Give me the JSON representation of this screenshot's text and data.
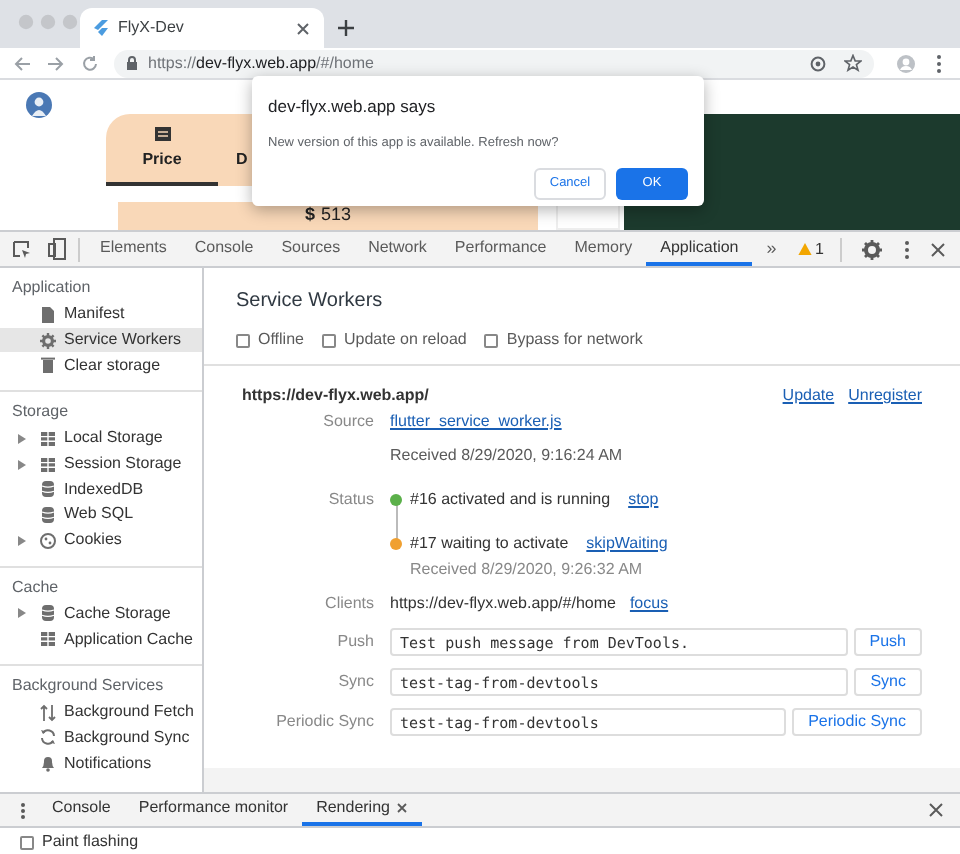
{
  "browser": {
    "tab": {
      "title": "FlyX-Dev"
    },
    "url": {
      "scheme": "https://",
      "host": "dev-flyx.web.app",
      "path": "/#/home"
    }
  },
  "page": {
    "tabs": [
      {
        "label": "Price",
        "selected": true
      },
      {
        "label": "D",
        "selected": false
      }
    ],
    "price": {
      "currency": "$",
      "amount": "513"
    }
  },
  "dialog": {
    "title": "dev-flyx.web.app says",
    "message": "New version of this app is available. Refresh now?",
    "buttons": [
      {
        "label": "Cancel",
        "kind": "secondary"
      },
      {
        "label": "OK",
        "kind": "primary"
      }
    ]
  },
  "devtools": {
    "tabs": [
      {
        "label": "Elements",
        "selected": false
      },
      {
        "label": "Console",
        "selected": false
      },
      {
        "label": "Sources",
        "selected": false
      },
      {
        "label": "Network",
        "selected": false
      },
      {
        "label": "Performance",
        "selected": false
      },
      {
        "label": "Memory",
        "selected": false
      },
      {
        "label": "Application",
        "selected": true
      }
    ],
    "more": "»",
    "warnings": "1",
    "sidebar": [
      {
        "heading": "Application",
        "items": [
          {
            "label": "Manifest",
            "kind": "file",
            "selected": false
          },
          {
            "label": "Service Workers",
            "kind": "gear",
            "selected": true
          },
          {
            "label": "Clear storage",
            "kind": "trash",
            "selected": false
          }
        ]
      },
      {
        "heading": "Storage",
        "items": [
          {
            "label": "Local Storage",
            "kind": "grid",
            "selected": false,
            "expanded": false
          },
          {
            "label": "Session Storage",
            "kind": "grid",
            "selected": false,
            "expanded": false
          },
          {
            "label": "IndexedDB",
            "kind": "database",
            "selected": false
          },
          {
            "label": "Web SQL",
            "kind": "database",
            "selected": false
          },
          {
            "label": "Cookies",
            "kind": "cookie",
            "selected": false,
            "expanded": false
          }
        ]
      },
      {
        "heading": "Cache",
        "items": [
          {
            "label": "Cache Storage",
            "kind": "database",
            "selected": false,
            "expanded": false
          },
          {
            "label": "Application Cache",
            "kind": "grid",
            "selected": false
          }
        ]
      },
      {
        "heading": "Background Services",
        "items": [
          {
            "label": "Background Fetch",
            "kind": "arrows",
            "selected": false
          },
          {
            "label": "Background Sync",
            "kind": "sync",
            "selected": false
          },
          {
            "label": "Notifications",
            "kind": "bell",
            "selected": false
          }
        ]
      }
    ],
    "panel": {
      "title": "Service Workers",
      "options": [
        {
          "label": "Offline",
          "checked": false
        },
        {
          "label": "Update on reload",
          "checked": false
        },
        {
          "label": "Bypass for network",
          "checked": false
        }
      ],
      "worker": {
        "scope": "https://dev-flyx.web.app/",
        "actions": [
          "Update",
          "Unregister"
        ],
        "rows": [
          {
            "kind": "source",
            "label": "Source",
            "link": "flutter_service_worker.js",
            "received": "Received 8/29/2020, 9:16:24 AM"
          },
          {
            "kind": "status",
            "label": "Status",
            "entries": [
              {
                "text": "#16 activated and is running",
                "action": "stop",
                "color": "#5bb04a"
              },
              {
                "text": "#17 waiting to activate",
                "action": "skipWaiting",
                "color": "#f0a030",
                "received": "Received 8/29/2020, 9:26:32 AM"
              }
            ]
          },
          {
            "kind": "clients",
            "label": "Clients",
            "text": "https://dev-flyx.web.app/#/home",
            "action": "focus"
          },
          {
            "kind": "input",
            "label": "Push",
            "value": "Test push message from DevTools.",
            "button": "Push"
          },
          {
            "kind": "input",
            "label": "Sync",
            "value": "test-tag-from-devtools",
            "button": "Sync"
          },
          {
            "kind": "input",
            "label": "Periodic Sync",
            "value": "test-tag-from-devtools",
            "button": "Periodic Sync"
          }
        ]
      }
    },
    "drawer": {
      "tabs": [
        {
          "label": "Console",
          "selected": false,
          "closable": false
        },
        {
          "label": "Performance monitor",
          "selected": false,
          "closable": false
        },
        {
          "label": "Rendering",
          "selected": true,
          "closable": true
        }
      ],
      "options": [
        {
          "label": "Paint flashing",
          "checked": false
        }
      ]
    }
  }
}
